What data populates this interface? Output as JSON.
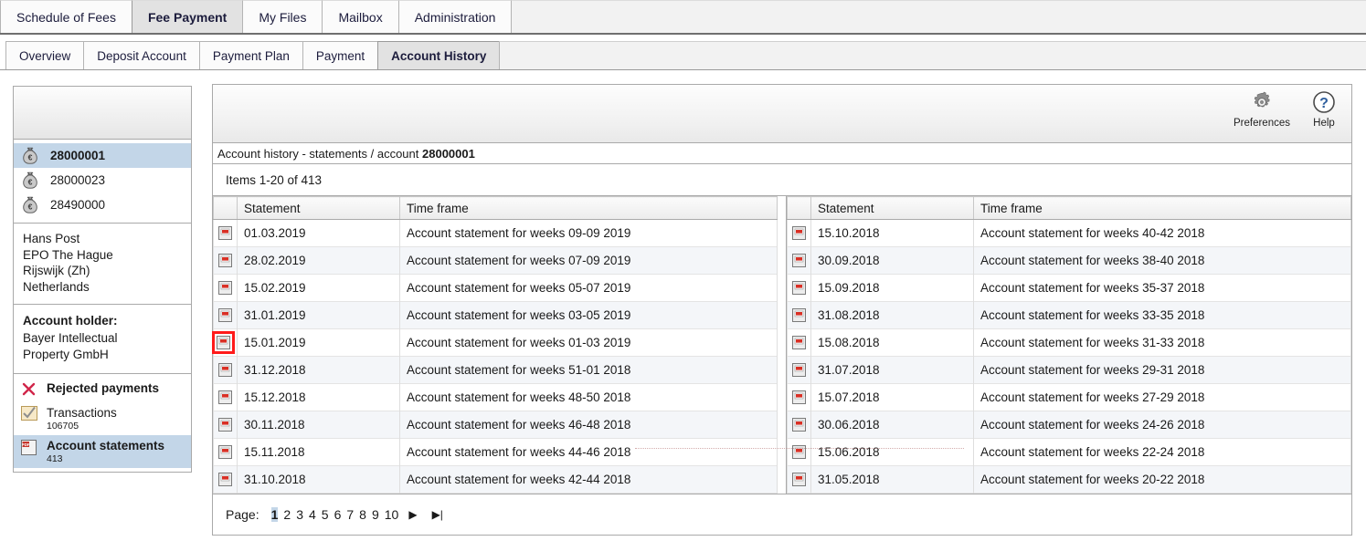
{
  "main_tabs": [
    {
      "label": "Schedule of Fees",
      "active": false
    },
    {
      "label": "Fee Payment",
      "active": true
    },
    {
      "label": "My Files",
      "active": false
    },
    {
      "label": "Mailbox",
      "active": false
    },
    {
      "label": "Administration",
      "active": false
    }
  ],
  "sub_tabs": [
    {
      "label": "Overview",
      "active": false
    },
    {
      "label": "Deposit Account",
      "active": false
    },
    {
      "label": "Payment Plan",
      "active": false
    },
    {
      "label": "Payment",
      "active": false
    },
    {
      "label": "Account History",
      "active": true
    }
  ],
  "sidebar": {
    "accounts": [
      {
        "number": "28000001",
        "selected": true,
        "icon": "money-bag-icon"
      },
      {
        "number": "28000023",
        "selected": false,
        "icon": "money-bag-icon"
      },
      {
        "number": "28490000",
        "selected": false,
        "icon": "money-bag-icon"
      }
    ],
    "address": [
      "Hans Post",
      "EPO The Hague",
      "Rijswijk (Zh)",
      "Netherlands"
    ],
    "account_holder": {
      "title": "Account holder:",
      "lines": [
        "Bayer Intellectual",
        "Property GmbH"
      ]
    },
    "nav": [
      {
        "label": "Rejected payments",
        "count": "",
        "icon": "red-x-icon",
        "selected": false,
        "bold": true
      },
      {
        "label": "Transactions",
        "count": "106705",
        "icon": "checkbox-check-icon",
        "selected": false,
        "bold": false
      },
      {
        "label": "Account statements",
        "count": "413",
        "icon": "pdf-icon",
        "selected": true,
        "bold": true
      }
    ]
  },
  "toolbar": {
    "preferences_label": "Preferences",
    "preferences_icon": "gear-icon",
    "help_label": "Help",
    "help_icon": "question-circle-icon"
  },
  "breadcrumb": {
    "prefix": "Account history - statements / account ",
    "account": "28000001"
  },
  "items_count": "Items 1-20 of 413",
  "table": {
    "columns": [
      "Statement",
      "Time frame"
    ],
    "row_icon": "pdf-icon",
    "left_rows": [
      {
        "statement": "01.03.2019",
        "time_frame": "Account statement for weeks 09-09 2019",
        "highlighted": false
      },
      {
        "statement": "28.02.2019",
        "time_frame": "Account statement for weeks 07-09 2019",
        "highlighted": false
      },
      {
        "statement": "15.02.2019",
        "time_frame": "Account statement for weeks 05-07 2019",
        "highlighted": false
      },
      {
        "statement": "31.01.2019",
        "time_frame": "Account statement for weeks 03-05 2019",
        "highlighted": false
      },
      {
        "statement": "15.01.2019",
        "time_frame": "Account statement for weeks 01-03 2019",
        "highlighted": true
      },
      {
        "statement": "31.12.2018",
        "time_frame": "Account statement for weeks 51-01 2018",
        "highlighted": false
      },
      {
        "statement": "15.12.2018",
        "time_frame": "Account statement for weeks 48-50 2018",
        "highlighted": false
      },
      {
        "statement": "30.11.2018",
        "time_frame": "Account statement for weeks 46-48 2018",
        "highlighted": false
      },
      {
        "statement": "15.11.2018",
        "time_frame": "Account statement for weeks 44-46 2018",
        "highlighted": false
      },
      {
        "statement": "31.10.2018",
        "time_frame": "Account statement for weeks 42-44 2018",
        "highlighted": false
      }
    ],
    "right_rows": [
      {
        "statement": "15.10.2018",
        "time_frame": "Account statement for weeks 40-42 2018",
        "highlighted": false
      },
      {
        "statement": "30.09.2018",
        "time_frame": "Account statement for weeks 38-40 2018",
        "highlighted": false
      },
      {
        "statement": "15.09.2018",
        "time_frame": "Account statement for weeks 35-37 2018",
        "highlighted": false
      },
      {
        "statement": "31.08.2018",
        "time_frame": "Account statement for weeks 33-35 2018",
        "highlighted": false
      },
      {
        "statement": "15.08.2018",
        "time_frame": "Account statement for weeks 31-33 2018",
        "highlighted": false
      },
      {
        "statement": "31.07.2018",
        "time_frame": "Account statement for weeks 29-31 2018",
        "highlighted": false
      },
      {
        "statement": "15.07.2018",
        "time_frame": "Account statement for weeks 27-29 2018",
        "highlighted": false
      },
      {
        "statement": "30.06.2018",
        "time_frame": "Account statement for weeks 24-26 2018",
        "highlighted": false
      },
      {
        "statement": "15.06.2018",
        "time_frame": "Account statement for weeks 22-24 2018",
        "highlighted": false
      },
      {
        "statement": "31.05.2018",
        "time_frame": "Account statement for weeks 20-22 2018",
        "highlighted": false
      }
    ]
  },
  "pager": {
    "label": "Page:",
    "pages": [
      "1",
      "2",
      "3",
      "4",
      "5",
      "6",
      "7",
      "8",
      "9",
      "10"
    ],
    "current": "1",
    "next_icon": "next-page-icon",
    "last_icon": "last-page-icon"
  },
  "colors": {
    "selection": "#c3d6e8",
    "highlight_box": "#ff1a1a",
    "alt_row": "#f4f6f9",
    "border": "#a9a9a9"
  }
}
